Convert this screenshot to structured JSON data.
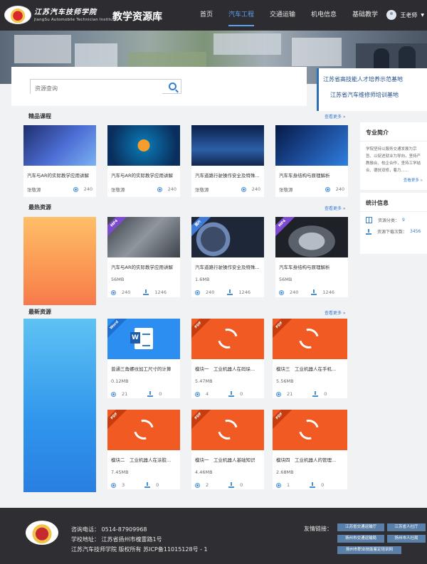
{
  "header": {
    "logo_cn": "江苏汽车技师学院",
    "logo_en": "JiangSu Automobile Technician Institute",
    "site_title": "教学资源库",
    "nav": [
      "首页",
      "汽车工程",
      "交通运输",
      "机电信息",
      "基础教学"
    ],
    "active_nav": "汽车工程",
    "user_name": "王老师"
  },
  "search": {
    "placeholder": "资源查询"
  },
  "slogan": {
    "line1": "江苏省高技能人才培养示范基地",
    "line2": "江苏省汽车维修师培训基地"
  },
  "sections": {
    "boutique": {
      "title": "精品课程",
      "more": "查看更多 »"
    },
    "hottest": {
      "title": "最热资源",
      "more": "查看更多 »"
    },
    "newest": {
      "title": "最新资源",
      "more": "查看更多 »"
    }
  },
  "boutique_courses": [
    {
      "title": "汽车与AR的实际教学应用讲解",
      "author": "张敬源",
      "views": "240"
    },
    {
      "title": "汽车与AR的实际教学应用讲解",
      "author": "张敬源",
      "views": "240"
    },
    {
      "title": "汽车道路行驶操作安全及特殊...",
      "author": "张敬源",
      "views": "240"
    },
    {
      "title": "汽车车身结构与原理解析",
      "author": "张敬源",
      "views": "240"
    }
  ],
  "hot_resources": [
    {
      "badge": "MP4",
      "title": "汽车与AR的实际教学应用讲解",
      "size": "56MB",
      "views": "240",
      "downloads": "1246"
    },
    {
      "badge": "图片",
      "title": "汽车道路行驶操作安全及特殊...",
      "size": "1.6MB",
      "views": "240",
      "downloads": "1246"
    },
    {
      "badge": "MP4",
      "title": "汽车车身结构与原理解析",
      "size": "56MB",
      "views": "240",
      "downloads": "1246"
    }
  ],
  "new_resources": [
    {
      "badge": "Word",
      "title": "普通三角螺纹加工尺寸的计算",
      "size": "0.12MB",
      "views": "21",
      "downloads": "0"
    },
    {
      "badge": "PDF",
      "title": "模块一　工业机器人在码垛...",
      "size": "5.47MB",
      "views": "4",
      "downloads": "0"
    },
    {
      "badge": "PDF",
      "title": "模块三　工业机器人在手机...",
      "size": "5.56MB",
      "views": "21",
      "downloads": "0"
    },
    {
      "badge": "PDF",
      "title": "模块二　工业机器人在涂胶...",
      "size": "7.45MB",
      "views": "3",
      "downloads": "0"
    },
    {
      "badge": "PDF",
      "title": "模块一　工业机器人基础知识",
      "size": "4.46MB",
      "views": "2",
      "downloads": "0"
    },
    {
      "badge": "PDF",
      "title": "模块四　工业机器人的管理...",
      "size": "2.68MB",
      "views": "1",
      "downloads": "0"
    }
  ],
  "sidebar": {
    "intro_title": "专业简介",
    "intro_text": "学院坚持以服务交通发展为宗旨、以促进就业为导向，坚持产教融合、校企合作，坚持工学结合、德技双修，着力......",
    "intro_more": "查看更多 »",
    "stats_title": "统计信息",
    "category_label": "资源分类：",
    "category_value": "9",
    "downloads_label": "资源下载次数：",
    "downloads_value": "3456"
  },
  "footer": {
    "phone": "咨询电话：  0514-87909968",
    "address": "学校地址：  江苏省扬州市槐雷路1号",
    "copyright": "江苏汽车技师学院    版权所有    苏ICP备11015128号 - 1",
    "links_label": "友情链接：",
    "links": [
      "江苏省交通运输厅",
      "江苏省人社厅",
      "扬州市交通运输局",
      "扬州市人社局",
      "扬州市职业技能鉴定培训网"
    ]
  },
  "colors": {
    "header_bg": "#2c2c31",
    "accent": "#3a7fcf",
    "pdf": "#f15a22",
    "word": "#2b8ef0",
    "footer_bg": "#2f2f33"
  },
  "icons": {
    "search": "search-icon",
    "views": "eye-icon",
    "downloads": "download-icon",
    "category": "grid-icon"
  }
}
